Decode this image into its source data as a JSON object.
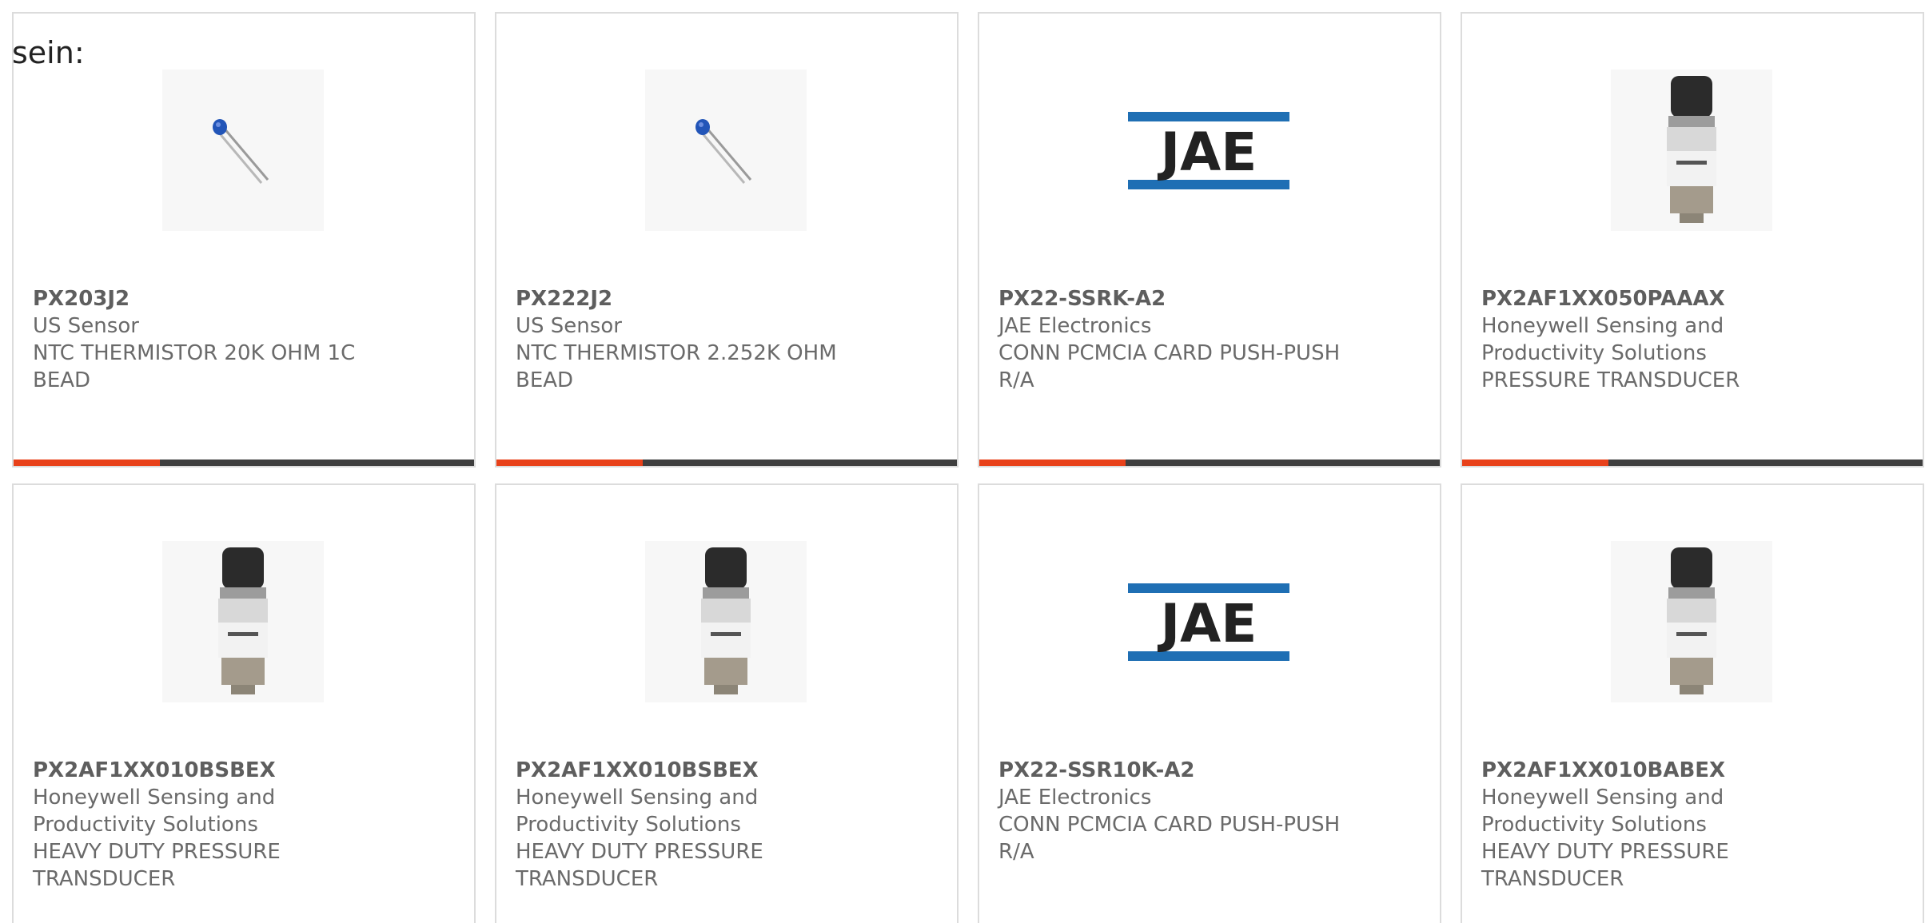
{
  "header_fragment": "sein:",
  "colors": {
    "accent": "#e8411a",
    "bar_dark": "#3f3f3f",
    "jae_blue": "#1f6fb4"
  },
  "products": [
    {
      "part_number": "PX203J2",
      "manufacturer": "US Sensor",
      "desc_line1": "NTC THERMISTOR 20K OHM 1C",
      "desc_line2": "BEAD",
      "desc_line3": "",
      "image": "thermistor-icon"
    },
    {
      "part_number": "PX222J2",
      "manufacturer": "US Sensor",
      "desc_line1": "NTC THERMISTOR 2.252K OHM",
      "desc_line2": "BEAD",
      "desc_line3": "",
      "image": "thermistor-icon"
    },
    {
      "part_number": "PX22-SSRK-A2",
      "manufacturer": "JAE Electronics",
      "desc_line1": "CONN PCMCIA CARD PUSH-PUSH",
      "desc_line2": "R/A",
      "desc_line3": "",
      "image": "jae-logo",
      "logo_text": "JAE"
    },
    {
      "part_number": "PX2AF1XX050PAAAX",
      "manufacturer": "Honeywell Sensing and",
      "desc_line1": "Productivity Solutions",
      "desc_line2": "PRESSURE TRANSDUCER",
      "desc_line3": "",
      "image": "pressure-transducer-icon"
    },
    {
      "part_number": "PX2AF1XX010BSBEX",
      "manufacturer": "Honeywell Sensing and",
      "desc_line1": "Productivity Solutions",
      "desc_line2": "HEAVY DUTY PRESSURE",
      "desc_line3": "TRANSDUCER",
      "image": "pressure-transducer-icon"
    },
    {
      "part_number": "PX2AF1XX010BSBEX",
      "manufacturer": "Honeywell Sensing and",
      "desc_line1": "Productivity Solutions",
      "desc_line2": "HEAVY DUTY PRESSURE",
      "desc_line3": "TRANSDUCER",
      "image": "pressure-transducer-icon"
    },
    {
      "part_number": "PX22-SSR10K-A2",
      "manufacturer": "JAE Electronics",
      "desc_line1": "CONN PCMCIA CARD PUSH-PUSH",
      "desc_line2": "R/A",
      "desc_line3": "",
      "image": "jae-logo",
      "logo_text": "JAE"
    },
    {
      "part_number": "PX2AF1XX010BABEX",
      "manufacturer": "Honeywell Sensing and",
      "desc_line1": "Productivity Solutions",
      "desc_line2": "HEAVY DUTY PRESSURE",
      "desc_line3": "TRANSDUCER",
      "image": "pressure-transducer-icon"
    }
  ]
}
